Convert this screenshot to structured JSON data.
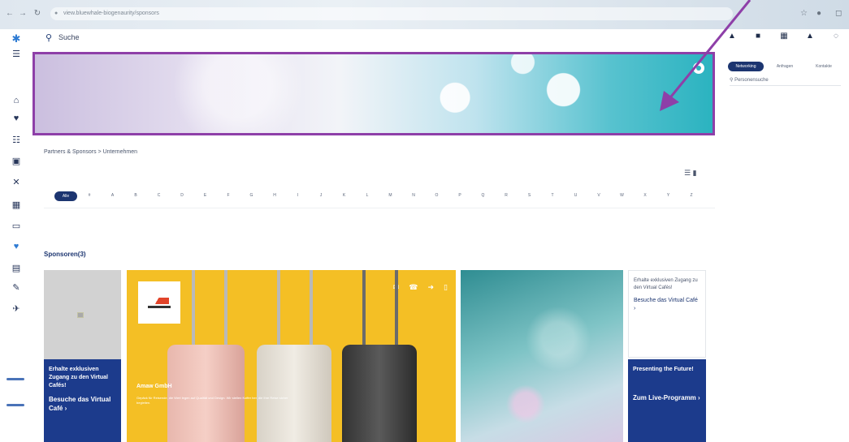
{
  "browser": {
    "url": "view.bluewhale-biogenaurity/sponsors",
    "icons": [
      "back-icon",
      "forward-icon",
      "reload-icon",
      "lock-icon",
      "star-icon",
      "profile-icon",
      "extension-icon"
    ]
  },
  "topbar": {
    "search_label": "Suche",
    "icons": [
      "user-icon",
      "chat-icon",
      "calendar-icon",
      "bell-icon",
      "settings-icon"
    ]
  },
  "sidebar": {
    "icons": [
      "logo-icon",
      "menu-icon",
      "home-icon",
      "heart-icon",
      "agenda-icon",
      "briefcase-icon",
      "network-icon",
      "building-icon",
      "chat-icon",
      "favorite-icon",
      "store-icon",
      "tools-icon",
      "plane-icon"
    ],
    "active_index": 9
  },
  "right_panel": {
    "tabs": [
      {
        "label": "Networking",
        "active": true
      },
      {
        "label": "Anfragen",
        "active": false
      },
      {
        "label": "Kontakte",
        "active": false
      }
    ],
    "search_placeholder": "Personensuche"
  },
  "breadcrumb": "Partners & Sponsors > Unternehmen",
  "alphabet": {
    "selected": "Alle",
    "letters": [
      "#",
      "A",
      "B",
      "C",
      "D",
      "E",
      "F",
      "G",
      "H",
      "I",
      "J",
      "K",
      "L",
      "M",
      "N",
      "O",
      "P",
      "Q",
      "R",
      "S",
      "T",
      "U",
      "V",
      "W",
      "X",
      "Y",
      "Z"
    ]
  },
  "section_title": "Sponsoren(3)",
  "cards": {
    "left_promo": {
      "line1": "Erhalte exklusiven Zugang zu den Virtual Cafés!",
      "cta": "Besuche das Virtual Café ›"
    },
    "featured": {
      "company": "Amaw GmbH",
      "description": "Gepäck für Reisende, die Wert legen auf Qualität und Design. Wir stellen Koffer her, die Ihre Reise sicher begleiten.",
      "icons": [
        "mail-icon",
        "phone-icon",
        "share-icon",
        "bookmark-icon"
      ]
    },
    "right_text": {
      "line1": "Erhalte exklusiven Zugang zu den Virtual Cafés!",
      "cta": "Besuche das Virtual Café ›"
    },
    "right_promo": {
      "line1": "Presenting the Future!",
      "cta": "Zum Live-Programm ›"
    }
  },
  "colors": {
    "highlight": "#8e3fa8",
    "brand_navy": "#1c3570",
    "brand_blue": "#1c3b8c",
    "accent_yellow": "#f4bf25"
  }
}
